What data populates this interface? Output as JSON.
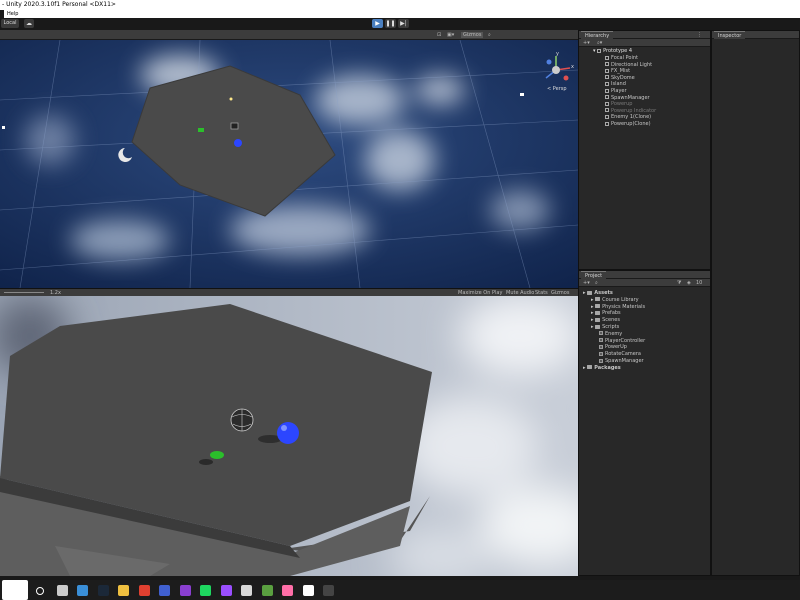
{
  "window": {
    "title": "- Unity 2020.3.10f1 Personal <DX11>",
    "menu_help": "Help"
  },
  "toolbar": {
    "account_label": "Local",
    "play_icon": "play-icon",
    "pause_icon": "pause-icon",
    "step_icon": "step-icon"
  },
  "scene": {
    "gizmos_label": "Gizmos",
    "persp_label": "< Persp",
    "gizmo_axis_y": "y",
    "gizmo_axis_x": "x"
  },
  "game": {
    "scale_label": "1.2x",
    "maximize_label": "Maximize On Play",
    "mute_label": "Mute Audio",
    "stats_label": "Stats",
    "gizmos_label": "Gizmos"
  },
  "hierarchy": {
    "tab_label": "Hierarchy",
    "root": "Prototype 4",
    "items": [
      {
        "label": "Focal Point",
        "indent": 1,
        "dim": false
      },
      {
        "label": "Directional Light",
        "indent": 1,
        "dim": false
      },
      {
        "label": "FX_Mist",
        "indent": 1,
        "dim": false
      },
      {
        "label": "SkyDome",
        "indent": 1,
        "dim": false
      },
      {
        "label": "Island",
        "indent": 1,
        "dim": false
      },
      {
        "label": "Player",
        "indent": 1,
        "dim": false
      },
      {
        "label": "SpawnManager",
        "indent": 1,
        "dim": false
      },
      {
        "label": "Powerup",
        "indent": 1,
        "dim": true
      },
      {
        "label": "Powerup Indicator",
        "indent": 1,
        "dim": true
      },
      {
        "label": "Enemy 1(Clone)",
        "indent": 1,
        "dim": false
      },
      {
        "label": "Powerup(Clone)",
        "indent": 1,
        "dim": false
      }
    ]
  },
  "inspector": {
    "tab_label": "Inspector"
  },
  "project": {
    "tab_label": "Project",
    "count_label": "10",
    "tree": [
      {
        "label": "Assets",
        "indent": 0,
        "kind": "folder",
        "bold": true
      },
      {
        "label": "Course Library",
        "indent": 1,
        "kind": "folder",
        "bold": false
      },
      {
        "label": "Physics Materials",
        "indent": 1,
        "kind": "folder",
        "bold": false
      },
      {
        "label": "Prefabs",
        "indent": 1,
        "kind": "folder",
        "bold": false
      },
      {
        "label": "Scenes",
        "indent": 1,
        "kind": "folder",
        "bold": false
      },
      {
        "label": "Scripts",
        "indent": 1,
        "kind": "folder",
        "bold": false
      },
      {
        "label": "Enemy",
        "indent": 2,
        "kind": "script",
        "bold": false
      },
      {
        "label": "PlayerController",
        "indent": 2,
        "kind": "script",
        "bold": false
      },
      {
        "label": "PowerUp",
        "indent": 2,
        "kind": "script",
        "bold": false
      },
      {
        "label": "RotateCamera",
        "indent": 2,
        "kind": "script",
        "bold": false
      },
      {
        "label": "SpawnManager",
        "indent": 2,
        "kind": "script",
        "bold": false
      },
      {
        "label": "Packages",
        "indent": 0,
        "kind": "folder",
        "bold": true
      }
    ]
  },
  "taskbar": {
    "icons": [
      "start-icon",
      "search-circle-icon",
      "task-view-icon",
      "calculator-icon",
      "steam-icon",
      "file-explorer-icon",
      "chrome-icon",
      "chrome-profile-icon",
      "visual-studio-icon",
      "spotify-icon",
      "app-purple-icon",
      "unity-hub-icon",
      "minecraft-icon",
      "app-pink-icon",
      "unity-icon",
      "unity-editor-icon"
    ],
    "colors": {
      "taskbar": "#1c1c1c",
      "play": "#4a7fbf",
      "player_ball": "#2c46ff",
      "powerup": "#2bbf2b"
    }
  }
}
